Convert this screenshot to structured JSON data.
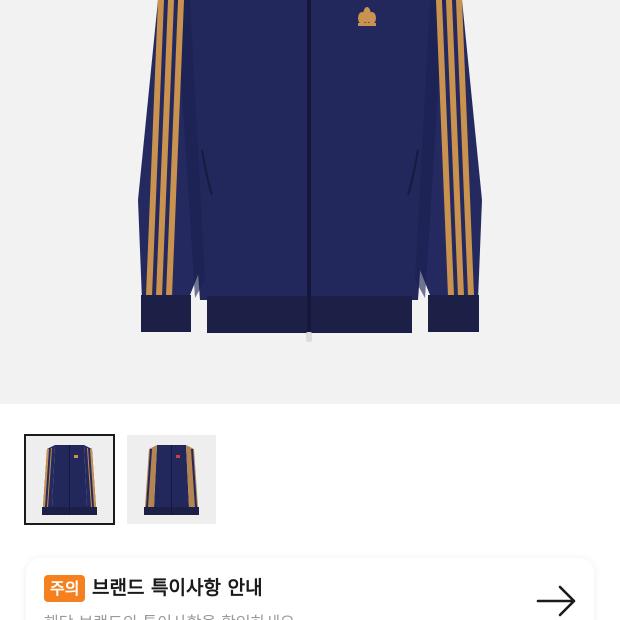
{
  "product": {
    "image_alt": "Navy track jacket with gold three stripes",
    "colors": {
      "navy": "#22285c",
      "stripe": "#c9924e",
      "cuff": "#1d2046",
      "background": "#f2f2f2"
    },
    "logo_icon": "trefoil-logo"
  },
  "thumbnails": [
    {
      "label": "thumbnail-1",
      "selected": true
    },
    {
      "label": "thumbnail-2",
      "selected": false
    }
  ],
  "notice": {
    "badge": "주의",
    "title": "브랜드 특이사항 안내",
    "subtitle": "해당 브랜드의 특이사항을 확인하세요",
    "arrow_icon": "arrow-right-icon",
    "badge_color": "#f5801f"
  }
}
